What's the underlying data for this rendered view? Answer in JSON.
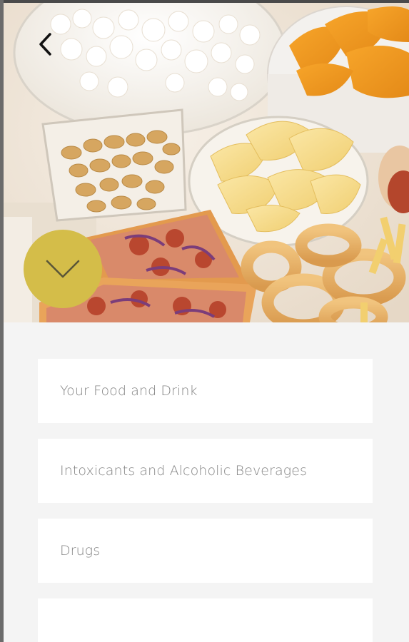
{
  "hero": {
    "image_description_icon": "snack-food-photo",
    "back_icon": "chevron-left-icon",
    "expand_icon": "chevron-down-icon",
    "expand_color": "#d4bd49"
  },
  "menu": {
    "items": [
      {
        "label": "Your Food and Drink"
      },
      {
        "label": "Intoxicants and Alcoholic Beverages"
      },
      {
        "label": "Drugs"
      },
      {
        "label": ""
      }
    ]
  }
}
